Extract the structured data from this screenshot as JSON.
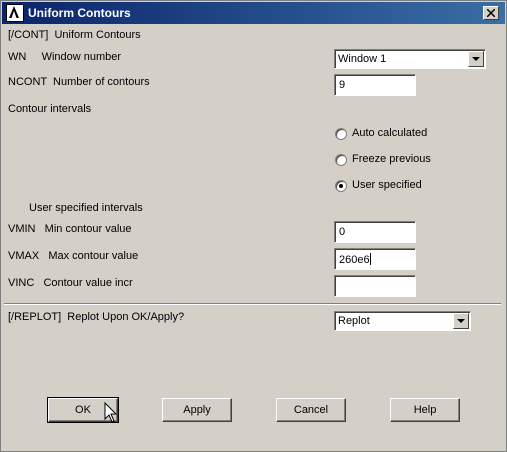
{
  "window": {
    "title": "Uniform Contours"
  },
  "header": {
    "command": "[/CONT]  Uniform Contours"
  },
  "wn": {
    "label": "WN     Window number",
    "value": "Window 1"
  },
  "ncont": {
    "label": "NCONT  Number of contours",
    "value": "9"
  },
  "intervals": {
    "label": "Contour intervals",
    "options": [
      {
        "label": "Auto calculated",
        "selected": false
      },
      {
        "label": "Freeze previous",
        "selected": false
      },
      {
        "label": "User specified",
        "selected": true
      }
    ]
  },
  "user_intervals": {
    "label": "User specified intervals"
  },
  "vmin": {
    "label": "VMIN   Min contour value",
    "value": "0"
  },
  "vmax": {
    "label": "VMAX   Max contour value",
    "value": "260e6"
  },
  "vinc": {
    "label": "VINC   Contour value incr",
    "value": ""
  },
  "replot": {
    "label": "[/REPLOT]  Replot Upon OK/Apply?",
    "value": "Replot"
  },
  "buttons": {
    "ok": "OK",
    "apply": "Apply",
    "cancel": "Cancel",
    "help": "Help"
  }
}
